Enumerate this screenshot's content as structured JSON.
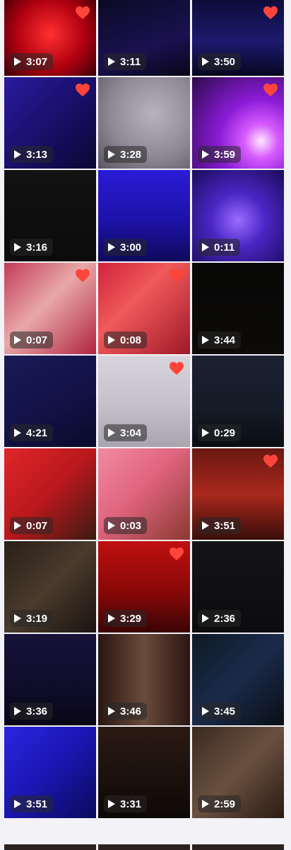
{
  "colors": {
    "favorite": "#ff453a",
    "background": "#f2f2f7"
  },
  "tiles": [
    {
      "duration": "3:07",
      "favorite": true,
      "bg": "radial-gradient(circle at 50% 45%, #ff3030 0%, #b00010 55%, #3a0008 100%)"
    },
    {
      "duration": "3:11",
      "favorite": false,
      "bg": "linear-gradient(160deg, #0b0a25 0%, #1a1150 60%, #080618 100%)"
    },
    {
      "duration": "3:50",
      "favorite": true,
      "bg": "linear-gradient(180deg, #0d0c3a 0%, #1c1a6e 55%, #070620 100%)"
    },
    {
      "duration": "3:13",
      "favorite": true,
      "bg": "linear-gradient(135deg, #2a1b9e 0%, #1a0f6b 50%, #0b0733 100%)"
    },
    {
      "duration": "3:28",
      "favorite": false,
      "bg": "radial-gradient(circle at 60% 40%, #b8b2bd 0%, #8f8996 55%, #5a5561 100%)"
    },
    {
      "duration": "3:59",
      "favorite": true,
      "bg": "radial-gradient(circle at 75% 70%, #ffe8ff 0%, #d75bff 18%, #8a1bd6 45%, #2b0a4a 100%)"
    },
    {
      "duration": "3:16",
      "favorite": false,
      "bg": "linear-gradient(180deg, #121212 0%, #0b0b0b 100%)"
    },
    {
      "duration": "3:00",
      "favorite": false,
      "bg": "linear-gradient(180deg, #2c1bd6 0%, #1d12a8 55%, #0e0a5c 100%)"
    },
    {
      "duration": "0:11",
      "favorite": false,
      "bg": "radial-gradient(circle at 50% 55%, #9b6cff 0%, #4a26c4 40%, #1a0b5a 100%)"
    },
    {
      "duration": "0:07",
      "favorite": true,
      "bg": "linear-gradient(135deg, #c23a5a 0%, #e8a8a8 45%, #b02440 100%)"
    },
    {
      "duration": "0:08",
      "favorite": true,
      "bg": "linear-gradient(135deg, #d0223a 0%, #f05a5a 40%, #a01828 100%)"
    },
    {
      "duration": "3:44",
      "favorite": false,
      "bg": "linear-gradient(180deg, #070707 0%, #0d0b08 100%)"
    },
    {
      "duration": "4:21",
      "favorite": false,
      "bg": "linear-gradient(150deg, #1a1a55 0%, #13134a 50%, #0a0a2a 100%)"
    },
    {
      "duration": "3:04",
      "favorite": true,
      "bg": "linear-gradient(180deg, #d8d4dc 0%, #c4bfc8 55%, #a9a4ae 100%)"
    },
    {
      "duration": "0:29",
      "favorite": false,
      "bg": "linear-gradient(180deg, #1b2130 0%, #141a26 60%, #0a0d14 100%)"
    },
    {
      "duration": "0:07",
      "favorite": false,
      "bg": "linear-gradient(135deg, #e0262a 0%, #b8181c 50%, #3a1a12 100%)"
    },
    {
      "duration": "0:03",
      "favorite": false,
      "bg": "linear-gradient(135deg, #f28aa2 0%, #e0647e 45%, #8a3a30 100%)"
    },
    {
      "duration": "3:51",
      "favorite": true,
      "bg": "linear-gradient(180deg, #6a1812 0%, #a8281c 50%, #3a0e0a 100%)"
    },
    {
      "duration": "3:19",
      "favorite": false,
      "bg": "linear-gradient(135deg, #2a201a 0%, #4a3a2c 50%, #1a1410 100%)"
    },
    {
      "duration": "3:29",
      "favorite": true,
      "bg": "linear-gradient(180deg, #c01010 0%, #8a0808 55%, #3a0404 100%)"
    },
    {
      "duration": "2:36",
      "favorite": false,
      "bg": "linear-gradient(180deg, #141416 0%, #0c0c0e 100%)"
    },
    {
      "duration": "3:36",
      "favorite": false,
      "bg": "linear-gradient(180deg, #16123a 0%, #0f0c2a 60%, #080616 100%)"
    },
    {
      "duration": "3:46",
      "favorite": false,
      "bg": "linear-gradient(90deg, #2a1612 0%, #6a4a3a 50%, #2a1612 100%)"
    },
    {
      "duration": "3:45",
      "favorite": false,
      "bg": "linear-gradient(135deg, #0e1a24 0%, #1a2a4a 50%, #0a0f16 100%)"
    },
    {
      "duration": "3:51",
      "favorite": false,
      "bg": "linear-gradient(135deg, #2a26e0 0%, #1a16b0 50%, #0c0a5a 100%)"
    },
    {
      "duration": "3:31",
      "favorite": false,
      "bg": "linear-gradient(180deg, #2a1a12 0%, #1a100c 60%, #0c0806 100%)"
    },
    {
      "duration": "2:59",
      "favorite": false,
      "bg": "linear-gradient(135deg, #3a2a20 0%, #6a5040 50%, #2a1c14 100%)"
    }
  ]
}
